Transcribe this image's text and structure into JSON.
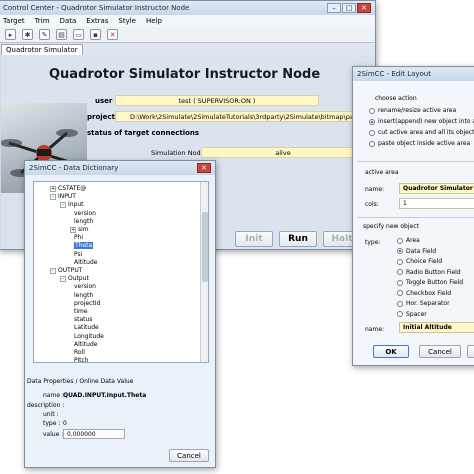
{
  "main_window": {
    "title": "Control Center - Quadrotor Simulator Instructor Node",
    "menu": [
      "Target",
      "Trim",
      "Data",
      "Extras",
      "Style",
      "Help"
    ],
    "tab": "Quadrotor Simulator",
    "heading": "Quadrotor Simulator Instructor Node",
    "user_label": "user",
    "user_value": "test ( SUPERVISOR:ON )",
    "project_label": "project",
    "project_value": "D:\\Work\\2Simulate\\2SimulateTutorials\\3rdparty\\2Simulate\\bitmap\\paper.2sp",
    "status_heading": "status of target connections",
    "node_label": "Simulation Node",
    "node_value": "alive",
    "buttons": {
      "init": "Init",
      "run": "Run",
      "halt": "Halt"
    }
  },
  "dict_window": {
    "title": "2SimCC - Data Dictionary",
    "tree": [
      {
        "label": "CSTATE@",
        "level": 1,
        "expander": "+"
      },
      {
        "label": "INPUT",
        "level": 1,
        "expander": "-"
      },
      {
        "label": "Input",
        "level": 2,
        "expander": "-"
      },
      {
        "label": "version",
        "level": 3,
        "expander": ""
      },
      {
        "label": "length",
        "level": 3,
        "expander": ""
      },
      {
        "label": "sim",
        "level": 3,
        "expander": "+"
      },
      {
        "label": "Phi",
        "level": 3,
        "expander": ""
      },
      {
        "label": "Theta",
        "level": 3,
        "expander": "",
        "selected": true
      },
      {
        "label": "Psi",
        "level": 3,
        "expander": ""
      },
      {
        "label": "Altitude",
        "level": 3,
        "expander": ""
      },
      {
        "label": "OUTPUT",
        "level": 1,
        "expander": "-"
      },
      {
        "label": "Output",
        "level": 2,
        "expander": "-"
      },
      {
        "label": "version",
        "level": 3,
        "expander": ""
      },
      {
        "label": "length",
        "level": 3,
        "expander": ""
      },
      {
        "label": "projectId",
        "level": 3,
        "expander": ""
      },
      {
        "label": "time",
        "level": 3,
        "expander": ""
      },
      {
        "label": "status",
        "level": 3,
        "expander": ""
      },
      {
        "label": "Latitude",
        "level": 3,
        "expander": ""
      },
      {
        "label": "Longitude",
        "level": 3,
        "expander": ""
      },
      {
        "label": "Altitude",
        "level": 3,
        "expander": ""
      },
      {
        "label": "Roll",
        "level": 3,
        "expander": ""
      },
      {
        "label": "Pitch",
        "level": 3,
        "expander": ""
      }
    ],
    "props_heading": "Data Properties / Online Data Value",
    "props": {
      "name_label": "name :",
      "name_value": "QUAD.INPUT.Input.Theta",
      "description_label": "description :",
      "unit_label": "unit :",
      "type_label": "type :",
      "type_value": "0",
      "value_label": "value :",
      "value_value": "0,000000"
    },
    "cancel": "Cancel"
  },
  "layout_window": {
    "title": "2SimCC - Edit Layout",
    "choose_action": "choose action",
    "actions": [
      {
        "label": "rename/resize active area",
        "checked": false
      },
      {
        "label": "insert(append) new object into act",
        "checked": true
      },
      {
        "label": "cut active area and all its objects",
        "checked": false
      },
      {
        "label": "paste object inside active area",
        "checked": false
      }
    ],
    "active_area": "active area",
    "name_label": "name:",
    "name_value": "Quadrotor Simulator",
    "cols_label": "cols:",
    "cols_value": "1",
    "specify": "specify new object",
    "type_label": "type:",
    "types": [
      {
        "label": "Area",
        "checked": false
      },
      {
        "label": "Data Field",
        "checked": true
      },
      {
        "label": "Choice Field",
        "checked": false
      },
      {
        "label": "Radio Button Field",
        "checked": false
      },
      {
        "label": "Toggle Button Field",
        "checked": false
      },
      {
        "label": "Checkbox Field",
        "checked": false
      },
      {
        "label": "Hor. Separator",
        "checked": false
      },
      {
        "label": "Spacer",
        "checked": false
      }
    ],
    "obj_name_label": "name:",
    "obj_name_value": "Initial Altitude",
    "ok": "OK",
    "cancel": "Cancel"
  },
  "colors": {
    "accent": "#3d7bd6",
    "field": "#fff7c6",
    "close": "#c9483b"
  }
}
